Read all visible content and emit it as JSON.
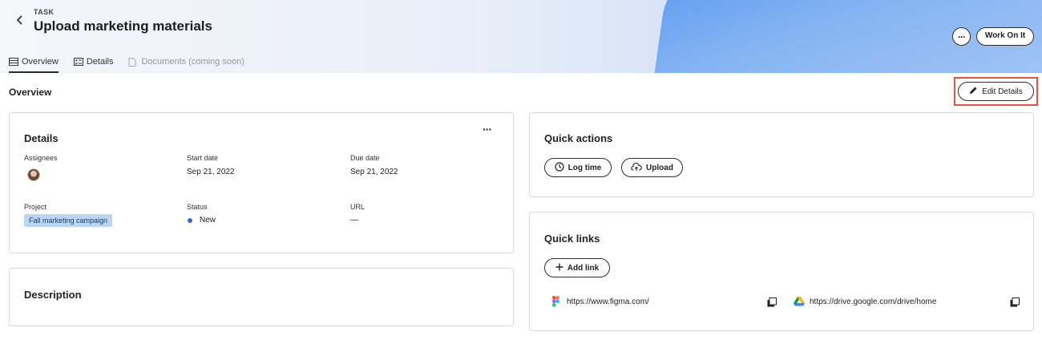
{
  "header": {
    "eyebrow": "TASK",
    "title": "Upload marketing materials",
    "tabs": [
      {
        "label": "Overview",
        "icon": "list-icon",
        "active": true
      },
      {
        "label": "Details",
        "icon": "checklist-icon"
      },
      {
        "label": "Documents (coming soon)",
        "icon": "document-icon",
        "disabled": true
      }
    ],
    "more_label": "···",
    "work_on_it_label": "Work On It"
  },
  "overview": {
    "label": "Overview",
    "edit_details_label": "Edit Details"
  },
  "details_card": {
    "title": "Details",
    "more_label": "···",
    "assignees_label": "Assignees",
    "start_date_label": "Start date",
    "start_date_value": "Sep 21, 2022",
    "due_date_label": "Due date",
    "due_date_value": "Sep 21, 2022",
    "project_label": "Project",
    "project_value": "Fall marketing campaign",
    "status_label": "Status",
    "status_value": "New",
    "url_label": "URL",
    "url_value": "—"
  },
  "description_card": {
    "title": "Description"
  },
  "quick_actions": {
    "title": "Quick actions",
    "log_time_label": "Log time",
    "upload_label": "Upload"
  },
  "quick_links": {
    "title": "Quick links",
    "add_link_label": "Add link",
    "links": [
      {
        "url": "https://www.figma.com/",
        "icon": "figma-icon"
      },
      {
        "url": "https://drive.google.com/drive/home",
        "icon": "google-drive-icon"
      }
    ]
  },
  "colors": {
    "accent_blue": "#5b9bf0",
    "highlight_frame": "#e8553e",
    "status_new": "#3b63d8",
    "project_tag": "#b9d6f5"
  }
}
